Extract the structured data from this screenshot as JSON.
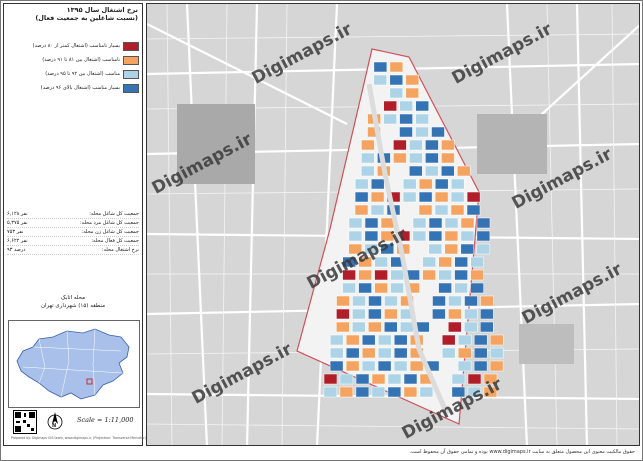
{
  "panel": {
    "title_line1": "نرخ اشتغال سال ۱۳۹۵",
    "title_line2": "(نسبت شاغلین به جمعیت فعال)",
    "legend": [
      {
        "label": "بسیار نامناسب (اشتغال کمتر از ۸۰ درصد)",
        "color": "#b01e2a"
      },
      {
        "label": "نامناسب (اشتغال بین ۸۱ تا ۹۱ درصد)",
        "color": "#f4a460"
      },
      {
        "label": "مناسب (اشتغال بین ۹۲ تا ۹۵ درصد)",
        "color": "#acd4e6"
      },
      {
        "label": "بسیار مناسب (اشتغال بالای ۹۶ درصد)",
        "color": "#3474b4"
      }
    ],
    "stats": [
      {
        "label": "جمعیت کل شاغل محله:",
        "value": "۶,۱۲۸ نفر"
      },
      {
        "label": "جمعیت کل شاغل مرد محله:",
        "value": "۵,۳۷۵ نفر"
      },
      {
        "label": "جمعیت کل شاغل زن محله:",
        "value": "۷۵۳ نفر"
      },
      {
        "label": "جمعیت کل فعال محله:",
        "value": "۶,۶۲۲ نفر"
      },
      {
        "label": "نرخ اشتغال محله:",
        "value": "۹۳ درصد"
      }
    ],
    "district_line1": "محله اتابک",
    "district_line2": "منطقه (۱۵) شهرداری تهران",
    "scale": "Scale = 1:11,000",
    "credit": "Prepared by: Digimaps GIS team, www.digimaps.ir, (Projection: Transverse Mercator)",
    "north_label": "N"
  },
  "map": {
    "watermark": "Digimaps.ir",
    "footer": "حقوق مالکیت معنوی این محصول متعلق به سایت www.digimaps.ir بوده و تمامی حقوق آن محفوظ است."
  }
}
